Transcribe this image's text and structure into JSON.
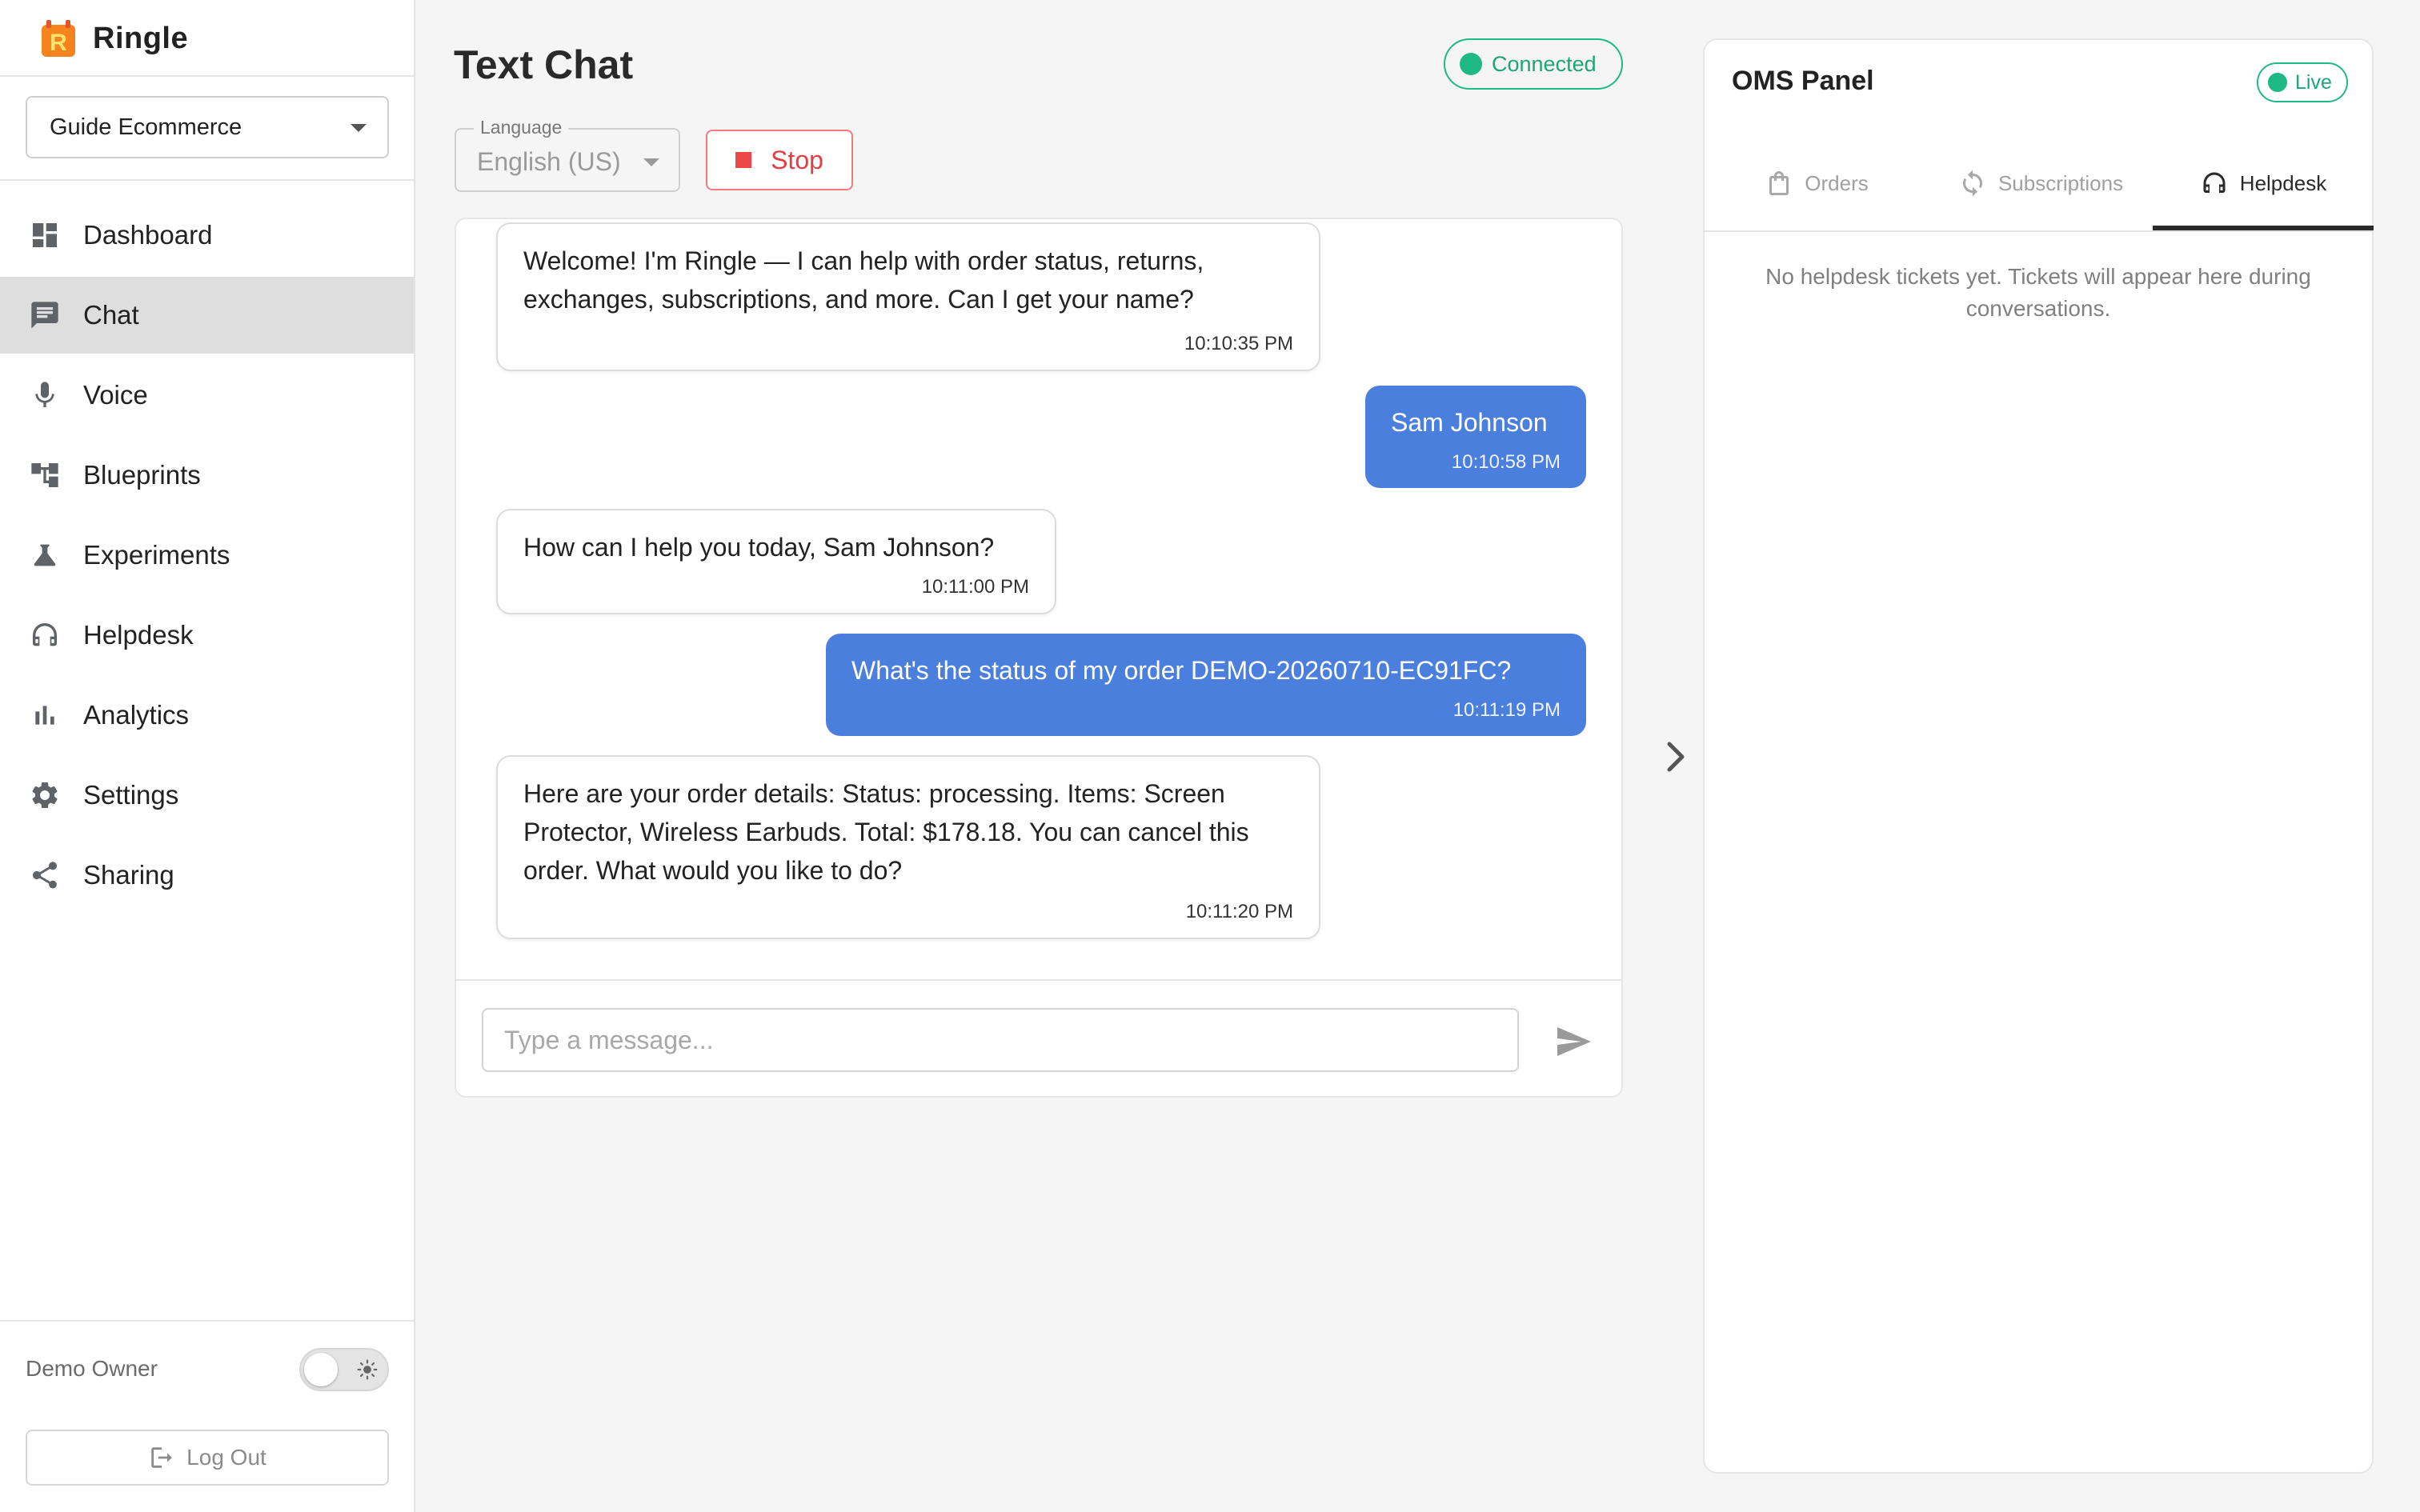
{
  "app": {
    "name": "Ringle",
    "logo_letter": "R"
  },
  "sidebar": {
    "workspace": "Guide Ecommerce",
    "items": [
      {
        "label": "Dashboard",
        "icon": "dashboard-icon"
      },
      {
        "label": "Chat",
        "icon": "chat-icon",
        "active": true
      },
      {
        "label": "Voice",
        "icon": "mic-icon"
      },
      {
        "label": "Blueprints",
        "icon": "blueprint-icon"
      },
      {
        "label": "Experiments",
        "icon": "flask-icon"
      },
      {
        "label": "Helpdesk",
        "icon": "headset-icon"
      },
      {
        "label": "Analytics",
        "icon": "bar-chart-icon"
      },
      {
        "label": "Settings",
        "icon": "gear-icon"
      },
      {
        "label": "Sharing",
        "icon": "share-icon"
      }
    ],
    "owner": "Demo Owner",
    "logout_label": "Log Out"
  },
  "chat": {
    "title": "Text Chat",
    "status": "Connected",
    "language_label": "Language",
    "language_value": "English (US)",
    "stop_label": "Stop",
    "messages": [
      {
        "role": "bot",
        "text": "Welcome! I'm Ringle — I can help with order status, returns, exchanges, subscriptions, and more. Can I get your name?",
        "time": "10:10:35 PM"
      },
      {
        "role": "user",
        "text": "Sam Johnson",
        "time": "10:10:58 PM"
      },
      {
        "role": "bot",
        "text": "How can I help you today, Sam Johnson?",
        "time": "10:11:00 PM"
      },
      {
        "role": "user",
        "text": "What's the status of my order DEMO-20260710-EC91FC?",
        "time": "10:11:19 PM"
      },
      {
        "role": "bot",
        "text": "Here are your order details: Status: processing. Items: Screen Protector, Wireless Earbuds. Total: $178.18. You can cancel this order. What would you like to do?",
        "time": "10:11:20 PM"
      }
    ],
    "input_placeholder": "Type a message..."
  },
  "oms": {
    "title": "OMS Panel",
    "status": "Live",
    "tabs": [
      {
        "label": "Orders",
        "icon": "shopping-bag-icon"
      },
      {
        "label": "Subscriptions",
        "icon": "refresh-icon"
      },
      {
        "label": "Helpdesk",
        "icon": "headset-icon",
        "active": true
      }
    ],
    "empty_text": "No helpdesk tickets yet. Tickets will appear here during conversations."
  },
  "colors": {
    "accent_blue": "#4a7fdd",
    "status_green": "#1fb985",
    "stop_red": "#e24040",
    "brand_orange": "#f5841f"
  }
}
